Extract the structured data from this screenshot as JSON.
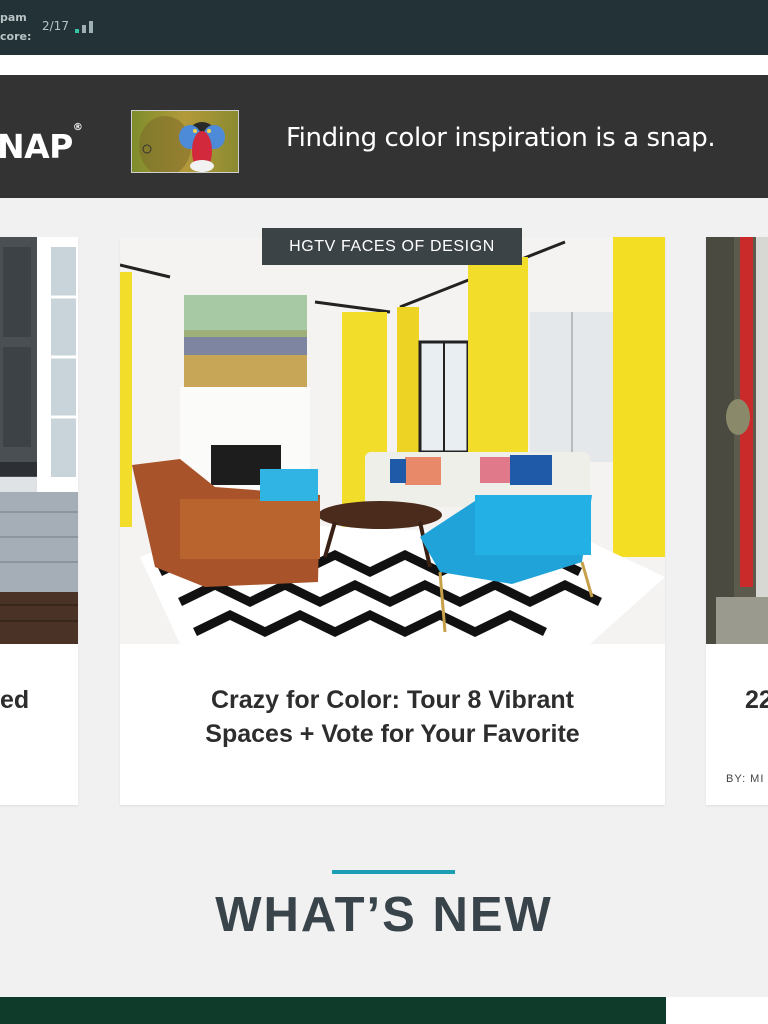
{
  "status": {
    "lines": [
      "pam",
      "core:"
    ],
    "score": "2/17"
  },
  "ad": {
    "logo_text": "NAP",
    "logo_mark": "®",
    "tagline": "Finding color inspiration is a snap."
  },
  "cards": {
    "left": {
      "title_fragment": "ed"
    },
    "center": {
      "badge": "HGTV FACES OF DESIGN",
      "title_line1": "Crazy for Color: Tour 8 Vibrant",
      "title_line2": "Spaces + Vote for Your Favorite"
    },
    "right": {
      "title_fragment": "22",
      "byline_fragment": "BY: MI"
    }
  },
  "section": {
    "title": "WHAT’S NEW"
  },
  "colors": {
    "topbar": "#223237",
    "ad_bg": "#333333",
    "accent": "#1c9fb5",
    "badge_bg": "#3b4347",
    "section_title": "#38444a"
  },
  "icons": [
    "signal-bars-icon"
  ]
}
